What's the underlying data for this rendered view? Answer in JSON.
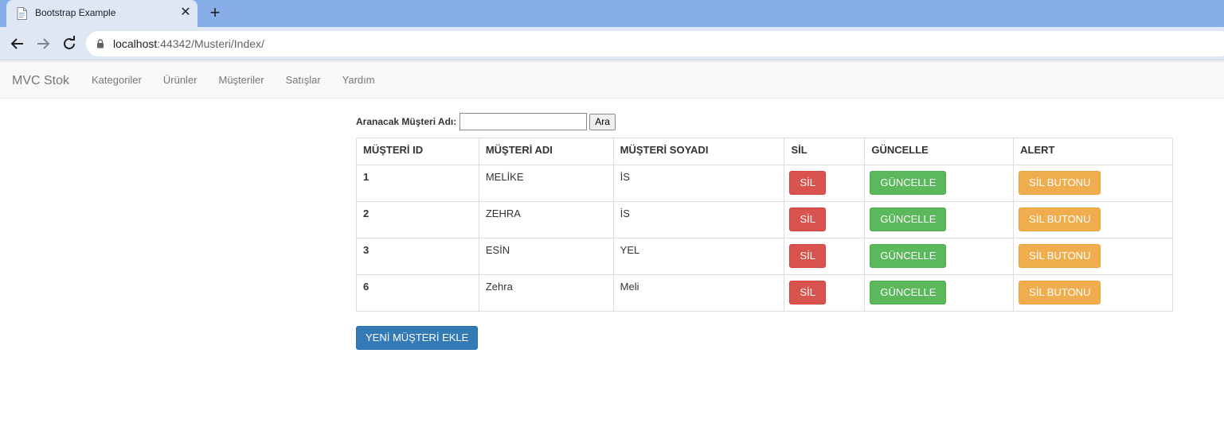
{
  "browser": {
    "tab_title": "Bootstrap Example",
    "url_host": "localhost",
    "url_rest": ":44342/Musteri/Index/"
  },
  "navbar": {
    "brand": "MVC Stok",
    "items": [
      {
        "label": "Kategoriler"
      },
      {
        "label": "Ürünler"
      },
      {
        "label": "Müşteriler"
      },
      {
        "label": "Satışlar"
      },
      {
        "label": "Yardım"
      }
    ]
  },
  "search": {
    "label": "Aranacak Müşteri Adı:",
    "value": "",
    "button_label": "Ara"
  },
  "table": {
    "headers": [
      "MÜŞTERİ ID",
      "MÜŞTERİ ADI",
      "MÜŞTERİ SOYADI",
      "SİL",
      "GÜNCELLE",
      "ALERT"
    ],
    "delete_label": "SİL",
    "update_label": "GÜNCELLE",
    "alert_label": "SİL BUTONU",
    "rows": [
      {
        "id": "1",
        "name": "MELİKE",
        "surname": "İS"
      },
      {
        "id": "2",
        "name": "ZEHRA",
        "surname": "İS"
      },
      {
        "id": "3",
        "name": "ESİN",
        "surname": "YEL"
      },
      {
        "id": "6",
        "name": "Zehra",
        "surname": "Meli"
      }
    ]
  },
  "add_button_label": "YENİ MÜŞTERİ EKLE",
  "colors": {
    "danger": "#d9534f",
    "success": "#5cb85c",
    "warning": "#f0ad4e",
    "primary": "#337ab7"
  }
}
